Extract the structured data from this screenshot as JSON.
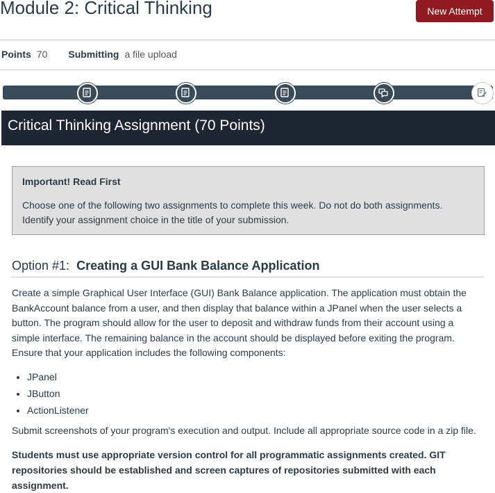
{
  "header": {
    "title": "Module 2: Critical Thinking",
    "new_attempt_label": "New Attempt"
  },
  "meta": {
    "points_label": "Points",
    "points_value": "70",
    "submitting_label": "Submitting",
    "submitting_value": "a file upload"
  },
  "module_nav": {
    "items": [
      {
        "icon": "document-icon"
      },
      {
        "icon": "document-icon"
      },
      {
        "icon": "document-icon"
      },
      {
        "icon": "discussion-icon"
      },
      {
        "icon": "edit-assignment-icon",
        "current": true
      }
    ]
  },
  "banner": {
    "title": "Critical Thinking Assignment (70 Points)"
  },
  "notice": {
    "title": "Important! Read First",
    "text": "Choose one of the following two assignments to complete this week. Do not do both assignments. Identify your assignment choice in the title of your submission."
  },
  "option1": {
    "prefix": "Option #1:",
    "title": "Creating a GUI Bank Balance Application",
    "description": "Create a simple Graphical User Interface (GUI) Bank Balance application. The application must obtain the BankAccount balance from a user, and then display that balance within a JPanel when the user selects a button. The program should allow for the user to deposit and withdraw funds from their account using a simple interface. The remaining balance in the account should be displayed before exiting the program. Ensure that your application includes the following components:",
    "components": [
      "JPanel",
      "JButton",
      "ActionListener"
    ],
    "submit_text": "Submit screenshots of your program's execution and output. Include all appropriate source code in a zip file.",
    "version_control_text": "Students must use appropriate version control for all programmatic assignments created. GIT repositories should be established and screen captures of repositories submitted with each assignment."
  }
}
